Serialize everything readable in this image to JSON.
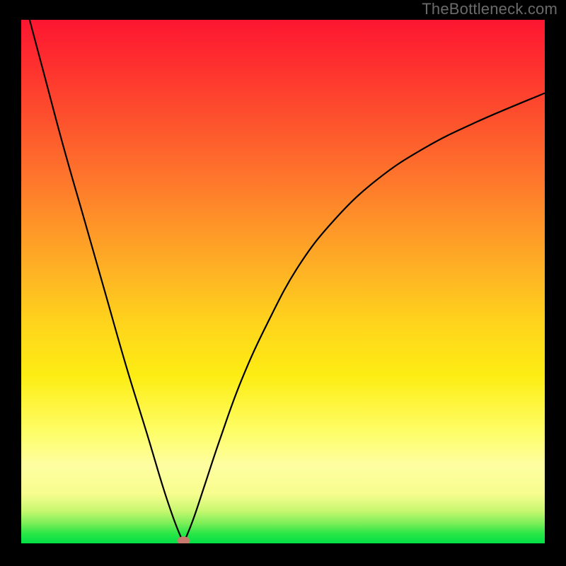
{
  "watermark": "TheBottleneck.com",
  "colors": {
    "background": "#000000",
    "gradient_top": "#fd1631",
    "gradient_bottom": "#02e045",
    "curve": "#000000",
    "dot": "#c8796e"
  },
  "chart_data": {
    "type": "line",
    "title": "",
    "xlabel": "",
    "ylabel": "",
    "xlim": [
      0,
      100
    ],
    "ylim": [
      0,
      100
    ],
    "annotations": [
      {
        "name": "minimum-marker",
        "x": 31,
        "y": 0.5
      }
    ],
    "series": [
      {
        "name": "bottleneck-curve",
        "x": [
          0,
          4,
          8,
          12,
          16,
          20,
          24,
          27,
          29,
          30.5,
          31,
          31.5,
          33,
          35,
          38,
          42,
          47,
          53,
          60,
          68,
          77,
          87,
          100
        ],
        "y": [
          106,
          91,
          76,
          62,
          48,
          34,
          21,
          11,
          5,
          1.2,
          0.5,
          1.2,
          5,
          11,
          20,
          31,
          42,
          53,
          62,
          69.5,
          75.5,
          80.5,
          86
        ]
      }
    ]
  }
}
